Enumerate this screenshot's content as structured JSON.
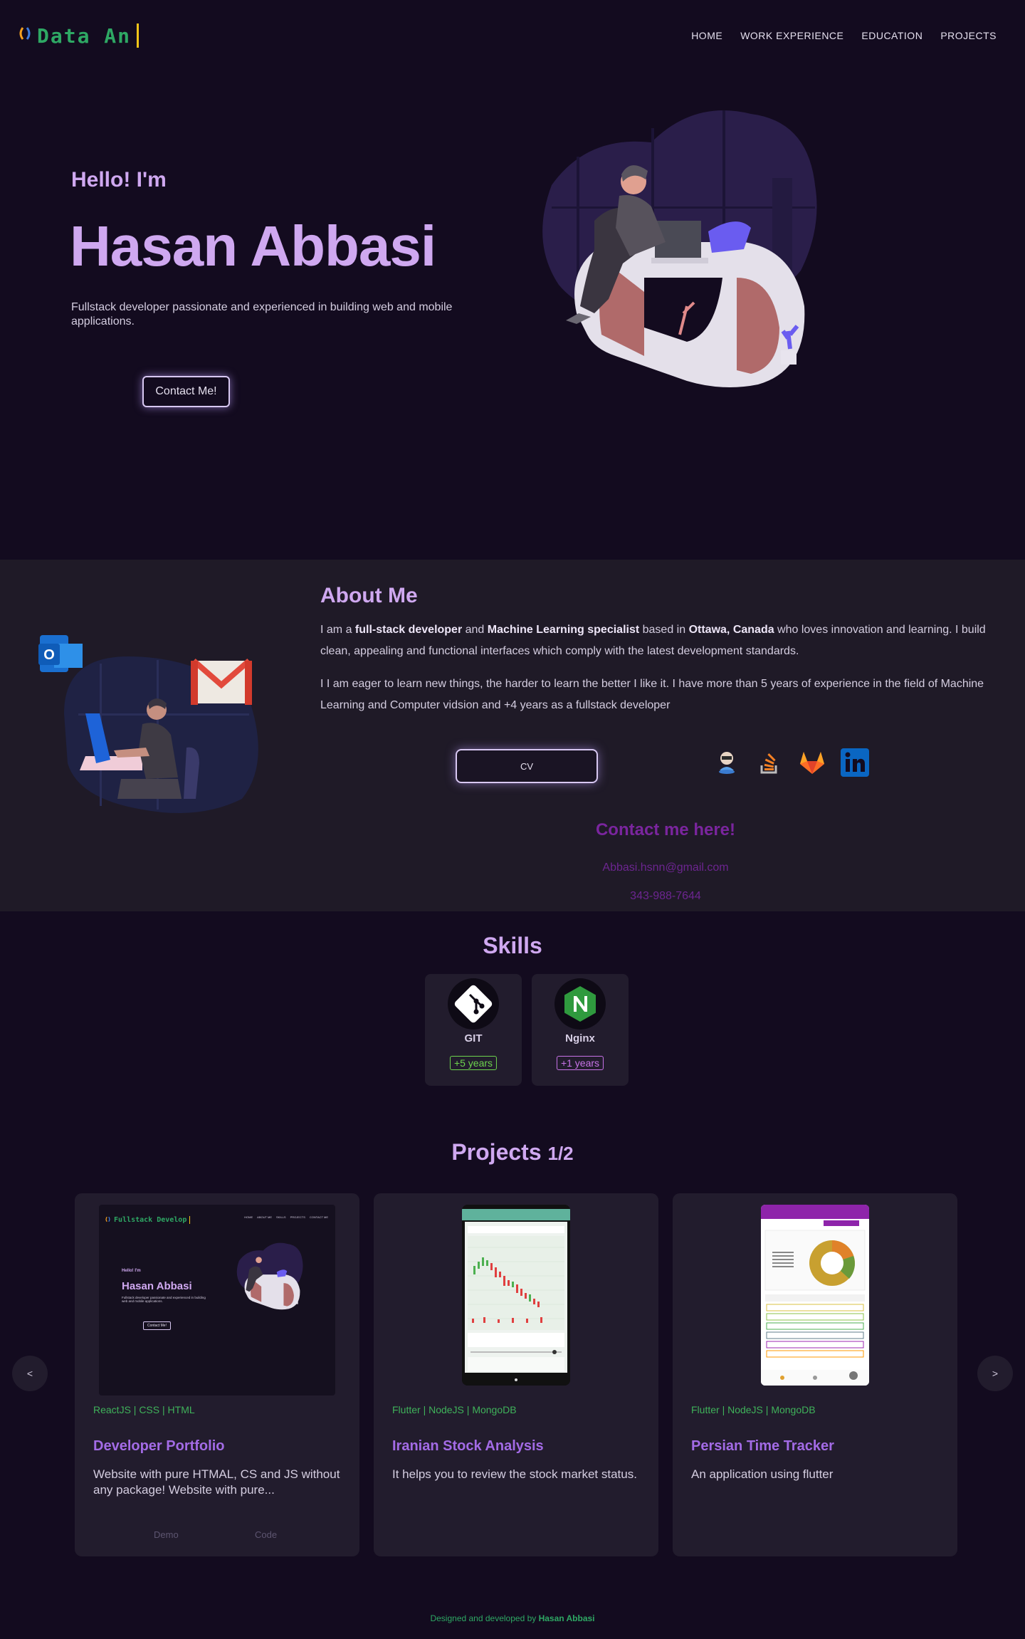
{
  "nav": {
    "logo_text": "Data An",
    "links": [
      "HOME",
      "WORK EXPERIENCE",
      "EDUCATION",
      "PROJECTS"
    ]
  },
  "hero": {
    "hello": "Hello! I'm",
    "name": "Hasan Abbasi",
    "description": "Fullstack developer passionate and experienced in building web and mobile applications.",
    "contact_button": "Contact Me!"
  },
  "about": {
    "title": "About Me",
    "p1_parts": [
      "I am a ",
      "full-stack developer",
      " and ",
      "Machine Learning specialist",
      " based in ",
      "Ottawa, Canada",
      " who loves innovation and learning. I build clean, appealing and functional interfaces which comply with the latest development standards."
    ],
    "p2": "I I am eager to learn new things, the harder to learn the better I like it. I have more than 5 years of experience in the field of Machine Learning and Computer vidsion and +4 years as a fullstack developer",
    "cv_button": "CV",
    "socials": [
      "github-icon",
      "stackoverflow-icon",
      "gitlab-icon",
      "linkedin-icon"
    ],
    "contact_title": "Contact me here!",
    "email": "Abbasi.hsnn@gmail.com",
    "phone": "343-988-7644"
  },
  "skills": {
    "title": "Skills",
    "items": [
      {
        "name": "GIT",
        "years": "+5 years",
        "color": "#6ed44e"
      },
      {
        "name": "Nginx",
        "years": "+1 years",
        "color": "#c873e8"
      }
    ]
  },
  "projects": {
    "title": "Projects",
    "page": "1/2",
    "prev": "<",
    "next": ">",
    "items": [
      {
        "tags": "ReactJS | CSS | HTML",
        "title": "Developer Portfolio",
        "description": "Website with pure HTMAL, CS and JS without any package! Website with pure...",
        "demo": "Demo",
        "code": "Code",
        "thumb": {
          "logo": "Fullstack Develop",
          "links": [
            "HOME",
            "ABOUT ME",
            "SKILLS",
            "PROJECTS",
            "CONTACT ME"
          ],
          "hello": "Hello! I'm",
          "name": "Hasan Abbasi",
          "desc": "Fullstack developer passionate and experienced in building web and mobile applications.",
          "btn": "Contact Me!"
        }
      },
      {
        "tags": "Flutter | NodeJS | MongoDB",
        "title": "Iranian Stock Analysis",
        "description": "It helps you to review the stock market status."
      },
      {
        "tags": "Flutter | NodeJS | MongoDB",
        "title": "Persian Time Tracker",
        "description": "An application using flutter"
      }
    ]
  },
  "footer": {
    "prefix": "Designed and developed by ",
    "name": "Hasan Abbasi"
  },
  "colors": {
    "background": "#130b1f",
    "accent": "#cfa8f0",
    "green": "#2ea864",
    "purple": "#a36be6"
  }
}
